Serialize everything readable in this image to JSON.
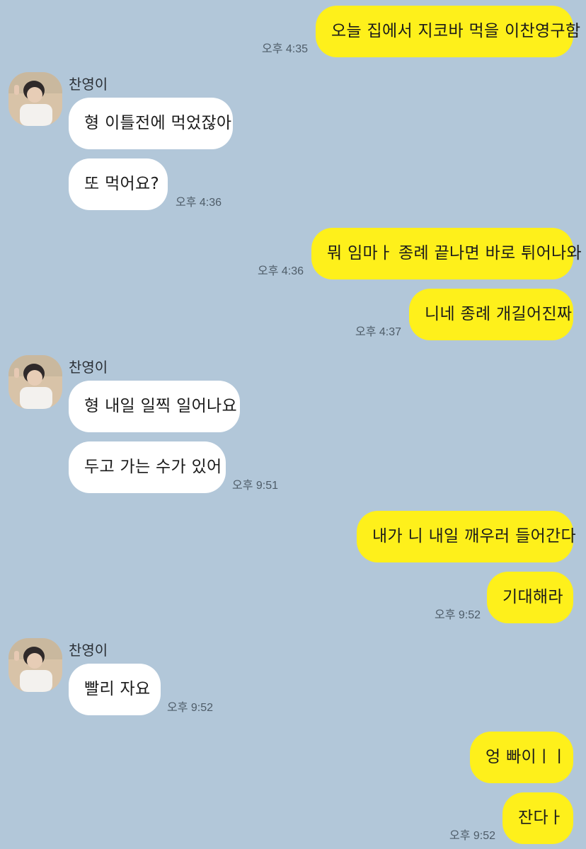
{
  "friend": {
    "name": "찬영이"
  },
  "messages": [
    {
      "text": "오늘 집에서 지코바 먹을 이찬영구함",
      "time": "오후 4:35"
    },
    {
      "text": "형 이틀전에 먹었잖아"
    },
    {
      "text": "또 먹어요?",
      "time": "오후 4:36"
    },
    {
      "text": "뭐 임마ㅏ 종례 끝나면 바로 튀어나와",
      "time": "오후 4:36"
    },
    {
      "text": "니네 종례 개길어진짜",
      "time": "오후 4:37"
    },
    {
      "text": "형 내일 일찍 일어나요"
    },
    {
      "text": "두고 가는 수가 있어",
      "time": "오후 9:51"
    },
    {
      "text": "내가 니 내일 깨우러 들어간다"
    },
    {
      "text": "기대해라",
      "time": "오후 9:52"
    },
    {
      "text": "빨리 자요",
      "time": "오후 9:52"
    },
    {
      "text": "엉 빠이ㅣㅣ"
    },
    {
      "text": "잔다ㅏ",
      "time": "오후 9:52"
    }
  ],
  "colors": {
    "background": "#b2c7d9",
    "my_bubble": "#fef01b",
    "friend_bubble": "#ffffff",
    "timestamp": "#4e5c68"
  }
}
